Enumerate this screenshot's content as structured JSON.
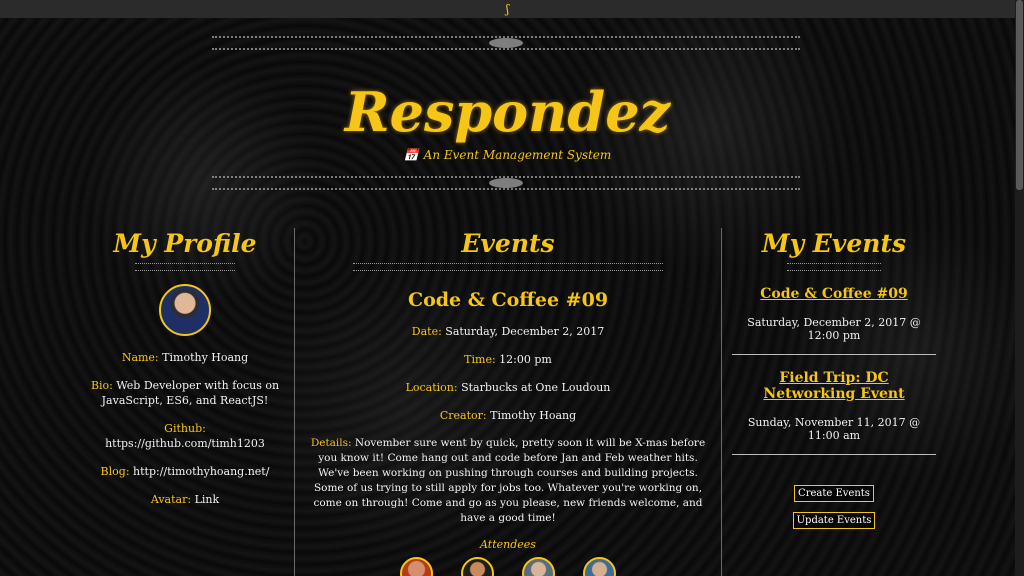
{
  "topbar": {
    "icon": "paperclip-icon",
    "icon_glyph": "ʃ"
  },
  "logo": {
    "title": "Respondez",
    "subtitle": "An Event Management System",
    "subtitle_icon": "calendar-icon",
    "subtitle_icon_glyph": "📅"
  },
  "profile": {
    "heading": "My Profile",
    "fields": [
      {
        "label": "Name:",
        "value": "Timothy Hoang"
      },
      {
        "label": "Bio:",
        "value": "Web Developer with focus on JavaScript, ES6, and ReactJS!"
      },
      {
        "label": "Github:",
        "value": "https://github.com/timh1203"
      },
      {
        "label": "Blog:",
        "value": "http://timothyhoang.net/"
      },
      {
        "label": "Avatar:",
        "value": "Link"
      }
    ]
  },
  "events": {
    "heading": "Events",
    "title": "Code & Coffee #09",
    "date_label": "Date:",
    "date": "Saturday, December 2, 2017",
    "time_label": "Time:",
    "time": "12:00 pm",
    "location_label": "Location:",
    "location": "Starbucks at One Loudoun",
    "creator_label": "Creator:",
    "creator": "Timothy Hoang",
    "details_label": "Details:",
    "details": "November sure went by quick, pretty soon it will be X-mas before you know it! Come hang out and code before Jan and Feb weather hits. We've been working on pushing through courses and building projects. Some of us trying to still apply for jobs too. Whatever you're working on, come on through! Come and go as you please, new friends welcome, and have a good time!",
    "attendees_title": "Attendees"
  },
  "my_events": {
    "heading": "My Events",
    "items": [
      {
        "title": "Code & Coffee #09",
        "date": "Saturday, December 2, 2017 @ 12:00 pm"
      },
      {
        "title": "Field Trip: DC Networking Event",
        "date": "Sunday, November 11, 2017 @ 11:00 am"
      }
    ],
    "create_button": "Create Events",
    "update_button": "Update Events"
  },
  "colors": {
    "accent": "#f5c518",
    "background": "#090909"
  }
}
